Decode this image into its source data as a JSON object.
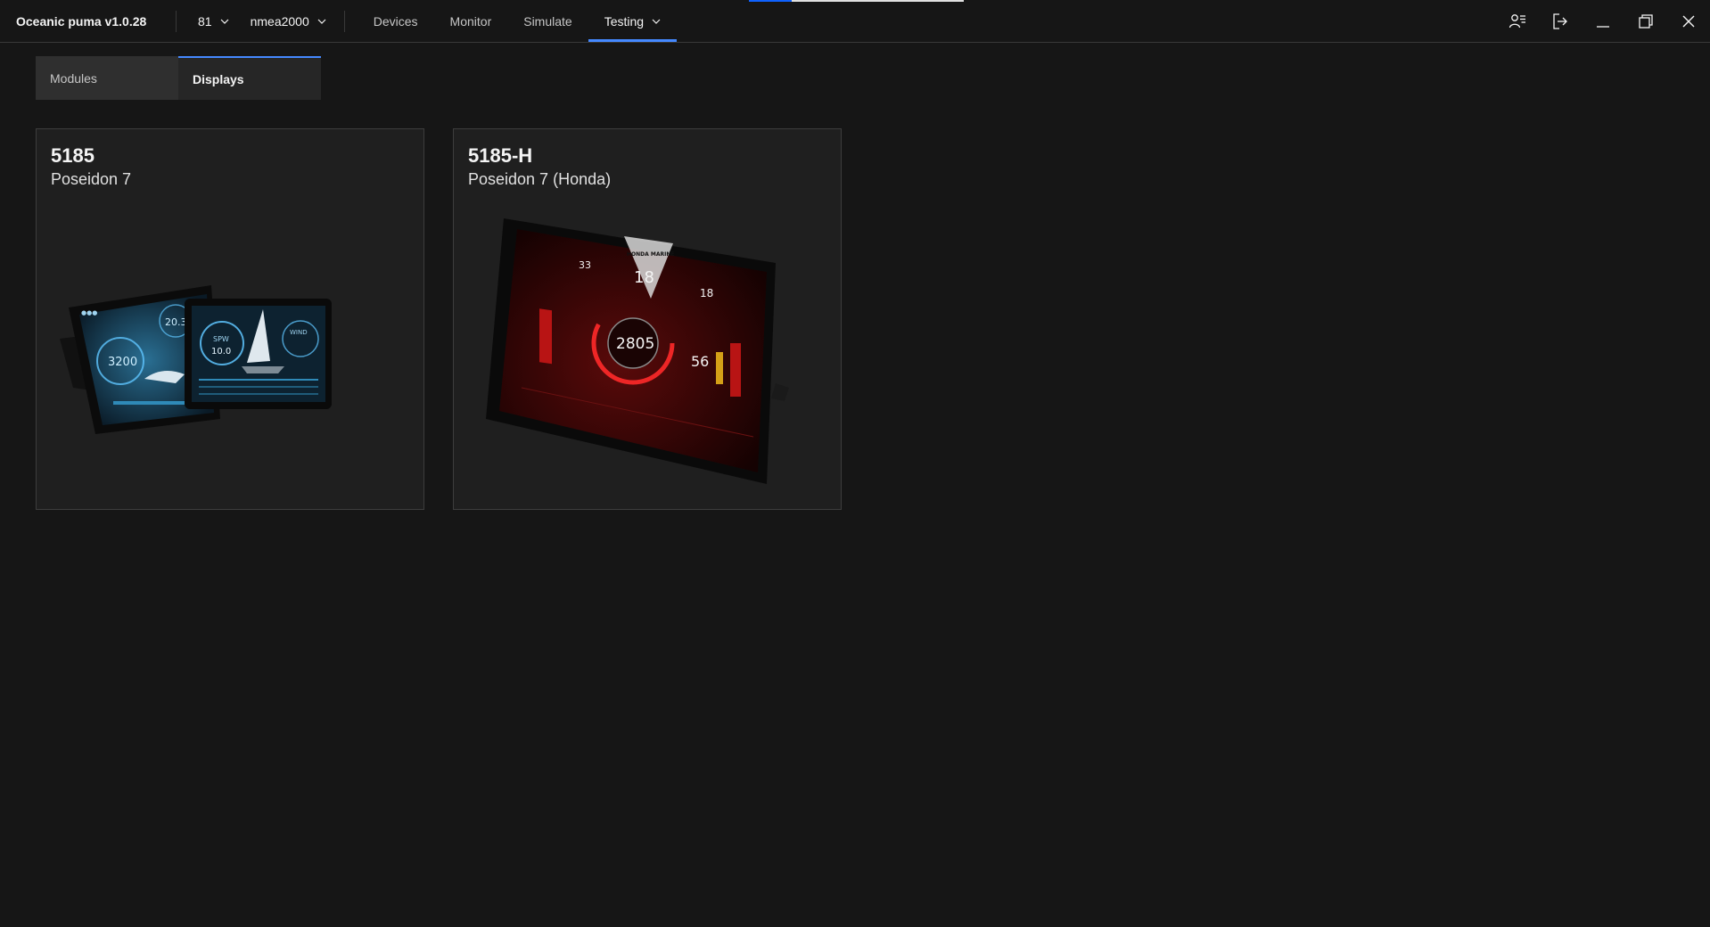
{
  "header": {
    "app_title": "Oceanic puma v1.0.28",
    "selector_1": "81",
    "selector_2": "nmea2000",
    "nav": [
      {
        "label": "Devices"
      },
      {
        "label": "Monitor"
      },
      {
        "label": "Simulate"
      },
      {
        "label": "Testing"
      }
    ],
    "accent": "#4589ff"
  },
  "tabs": [
    {
      "label": "Modules",
      "selected": false
    },
    {
      "label": "Displays",
      "selected": true
    }
  ],
  "cards": [
    {
      "model": "5185",
      "name": "Poseidon 7",
      "screens": {
        "gauge_a": "3200",
        "gauge_b": "20.3",
        "gauge_c": "3200",
        "speed": "10.0",
        "sog": "SPW",
        "wind": "WIND"
      }
    },
    {
      "model": "5185-H",
      "name": "Poseidon 7 (Honda)",
      "screens": {
        "rpm": "2805",
        "speed": "18",
        "left": "33",
        "right": "18",
        "temp": "56",
        "brand": "HONDA MARINE"
      }
    }
  ],
  "icons": [
    "user-list-icon",
    "logout-icon",
    "minimize-icon",
    "maximize-icon",
    "close-icon",
    "chevron-down-icon"
  ]
}
